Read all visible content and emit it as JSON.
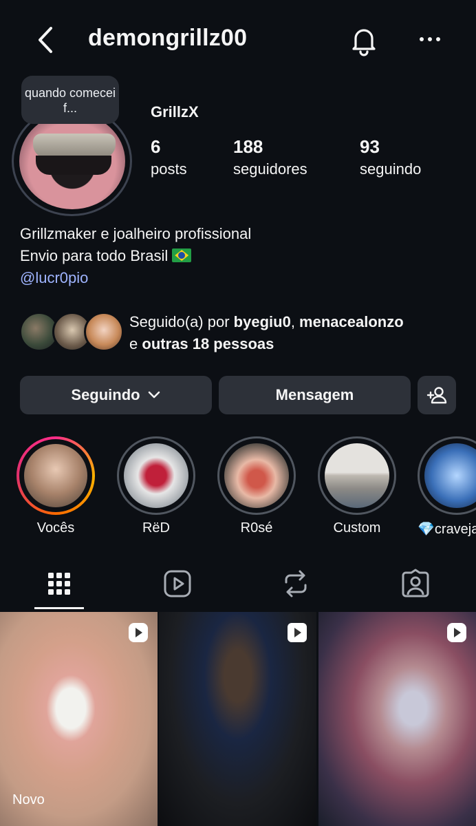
{
  "header": {
    "username": "demongrillz00"
  },
  "profile": {
    "note": "quando comecei f...",
    "display_name": "GrillzX",
    "stats": [
      {
        "value": "6",
        "label": "posts"
      },
      {
        "value": "188",
        "label": "seguidores"
      },
      {
        "value": "93",
        "label": "seguindo"
      }
    ],
    "bio": {
      "line1": "Grillzmaker e joalheiro profissional",
      "line2": "Envio para todo Brasil",
      "link": "@lucr0pio"
    },
    "followed_by": {
      "prefix": "Seguido(a) por",
      "user1": "byegiu0",
      "user2": "menacealonzo",
      "connector": "e",
      "others": "outras 18 pessoas"
    }
  },
  "actions": {
    "following": "Seguindo",
    "message": "Mensagem"
  },
  "highlights": [
    {
      "label": "Vocês"
    },
    {
      "label": "RëD"
    },
    {
      "label": "R0sé"
    },
    {
      "label": "Custom"
    },
    {
      "label": "💎craveja"
    }
  ],
  "grid": {
    "new_label": "Novo"
  }
}
